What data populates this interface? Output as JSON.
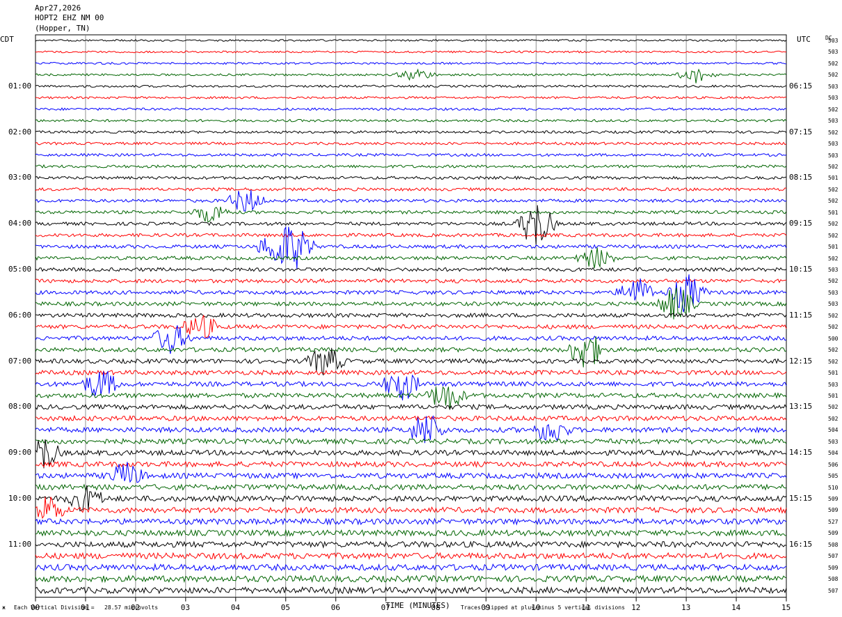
{
  "header": {
    "date": "Apr27,2026",
    "station": "HOPT2 EHZ NM 00",
    "location": "(Hopper, TN)"
  },
  "chart_data": {
    "type": "line",
    "description_type": "helicorder seismogram",
    "left_axis_title": "CDT",
    "right_axis_title": "UTC",
    "dc_title": "DC",
    "left_time_labels": [
      "01:00",
      "02:00",
      "03:00",
      "04:00",
      "05:00",
      "06:00",
      "07:00",
      "08:00",
      "09:00",
      "10:00",
      "11:00"
    ],
    "right_time_labels": [
      "06:15",
      "07:15",
      "08:15",
      "09:15",
      "10:15",
      "11:15",
      "12:15",
      "13:15",
      "14:15",
      "15:15",
      "16:15"
    ],
    "x_ticks": [
      "00",
      "01",
      "02",
      "03",
      "04",
      "05",
      "06",
      "07",
      "08",
      "09",
      "10",
      "11",
      "12",
      "13",
      "14",
      "15"
    ],
    "xlabel": "TIME (MINUTES)",
    "xlim": [
      0,
      15
    ],
    "lines_per_hour": 4,
    "minutes_per_line": 15,
    "trace_colors": [
      "#000000",
      "#ff0000",
      "#0000ff",
      "#006400"
    ],
    "dc_offsets": [
      "503",
      "503",
      "502",
      "502",
      "503",
      "503",
      "502",
      "503",
      "502",
      "503",
      "503",
      "502",
      "501",
      "502",
      "502",
      "501",
      "502",
      "502",
      "501",
      "502",
      "503",
      "502",
      "503",
      "503",
      "502",
      "502",
      "500",
      "502",
      "502",
      "501",
      "503",
      "501",
      "502",
      "502",
      "504",
      "503",
      "504",
      "506",
      "505",
      "510",
      "509",
      "509",
      "527",
      "509",
      "508",
      "507",
      "509",
      "508",
      "507"
    ],
    "events": [
      {
        "trace": 3,
        "minute": 7.6,
        "amplitude": 1.2
      },
      {
        "trace": 3,
        "minute": 13.2,
        "amplitude": 1.5
      },
      {
        "trace": 14,
        "minute": 4.2,
        "amplitude": 2.5
      },
      {
        "trace": 15,
        "minute": 3.5,
        "amplitude": 2.0
      },
      {
        "trace": 16,
        "minute": 10.0,
        "amplitude": 5.0
      },
      {
        "trace": 18,
        "minute": 4.8,
        "amplitude": 3.5
      },
      {
        "trace": 18,
        "minute": 5.2,
        "amplitude": 4.0
      },
      {
        "trace": 19,
        "minute": 11.2,
        "amplitude": 2.0
      },
      {
        "trace": 22,
        "minute": 12.0,
        "amplitude": 3.0
      },
      {
        "trace": 22,
        "minute": 13.0,
        "amplitude": 4.0
      },
      {
        "trace": 23,
        "minute": 12.8,
        "amplitude": 3.5
      },
      {
        "trace": 25,
        "minute": 3.3,
        "amplitude": 2.5
      },
      {
        "trace": 26,
        "minute": 2.7,
        "amplitude": 3.0
      },
      {
        "trace": 27,
        "minute": 11.0,
        "amplitude": 4.0
      },
      {
        "trace": 28,
        "minute": 5.8,
        "amplitude": 3.0
      },
      {
        "trace": 30,
        "minute": 1.3,
        "amplitude": 3.0
      },
      {
        "trace": 30,
        "minute": 7.3,
        "amplitude": 3.5
      },
      {
        "trace": 31,
        "minute": 8.2,
        "amplitude": 3.0
      },
      {
        "trace": 34,
        "minute": 7.8,
        "amplitude": 3.5
      },
      {
        "trace": 34,
        "minute": 10.3,
        "amplitude": 2.5
      },
      {
        "trace": 36,
        "minute": 0.1,
        "amplitude": 4.0
      },
      {
        "trace": 38,
        "minute": 1.8,
        "amplitude": 2.5
      },
      {
        "trace": 40,
        "minute": 1.0,
        "amplitude": 2.5
      },
      {
        "trace": 41,
        "minute": 0.2,
        "amplitude": 3.0
      }
    ]
  },
  "footer": {
    "left_note": "Each Vertical Division =   28.57 microvolts",
    "right_note": "Traces clipped at plus/minus 5 vertical divisions"
  }
}
